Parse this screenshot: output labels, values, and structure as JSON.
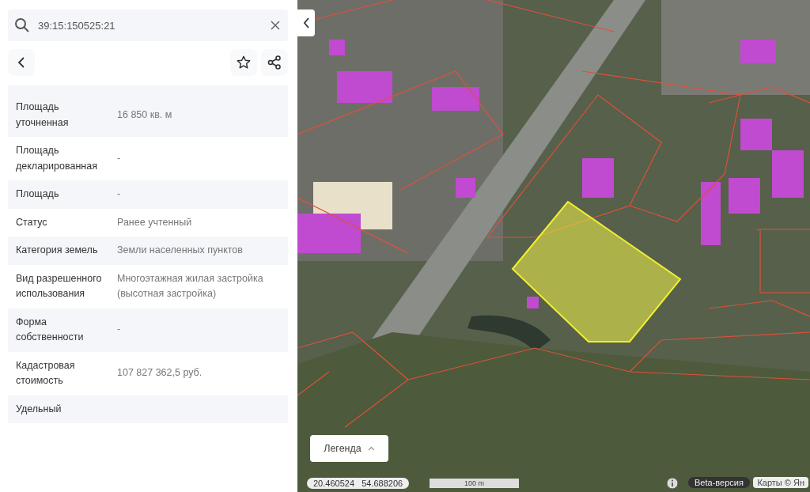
{
  "search": {
    "value": "39:15:150525:21"
  },
  "properties": [
    {
      "label": "Площадь уточненная",
      "value": "16 850 кв. м"
    },
    {
      "label": "Площадь декларированная",
      "value": "-"
    },
    {
      "label": "Площадь",
      "value": "-"
    },
    {
      "label": "Статус",
      "value": "Ранее учтенный"
    },
    {
      "label": "Категория земель",
      "value": "Земли населенных пунктов"
    },
    {
      "label": "Вид разрешенного использования",
      "value": "Многоэтажная жилая застройка (высотная застройка)"
    },
    {
      "label": "Форма собственности",
      "value": "-"
    },
    {
      "label": "Кадастровая стоимость",
      "value": "107 827 362,5 руб."
    },
    {
      "label": "Удельный"
    }
  ],
  "map": {
    "legend_button": "Легенда",
    "coordinates": "20.460524   54.688206",
    "scale": "100 m",
    "beta_badge": "Beta-версия",
    "attribution": "Карты © Ян"
  }
}
